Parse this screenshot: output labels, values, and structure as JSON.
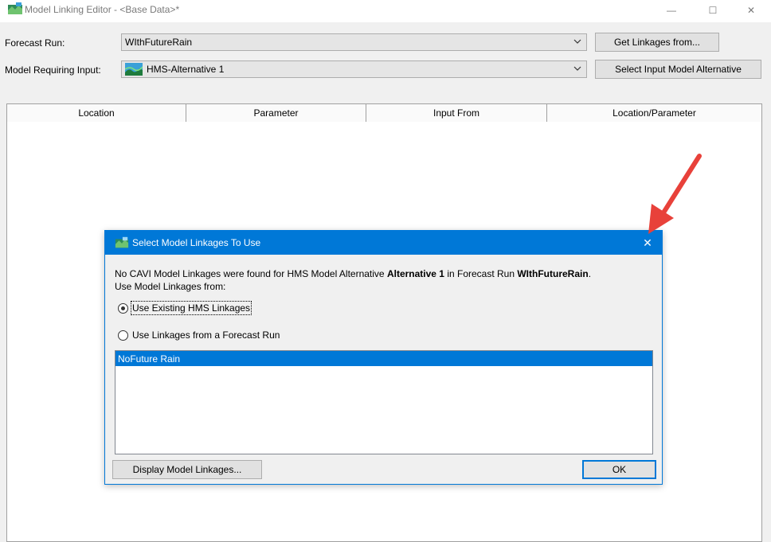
{
  "window": {
    "title": "Model Linking Editor - <Base Data>*",
    "min_glyph": "—",
    "max_glyph": "☐",
    "close_glyph": "✕"
  },
  "form": {
    "forecast_run_label": "Forecast Run:",
    "forecast_run_value": "WIthFutureRain",
    "model_input_label": "Model Requiring Input:",
    "model_input_value": "HMS-Alternative 1",
    "get_linkages_button": "Get Linkages from...",
    "select_input_button": "Select Input Model Alternative"
  },
  "table": {
    "columns": [
      "Location",
      "Parameter",
      "Input From",
      "Location/Parameter"
    ]
  },
  "dialog": {
    "title": "Select Model Linkages To Use",
    "close_glyph": "✕",
    "message_part1": "No CAVI Model Linkages were found for HMS Model Alternative ",
    "message_bold1": "Alternative 1",
    "message_part2": " in Forecast Run ",
    "message_bold2": "WIthFutureRain",
    "message_part3": ".",
    "message_line2": "Use Model Linkages from:",
    "option_existing": "Use Existing HMS Linkages",
    "option_forecast": "Use Linkages from a Forecast Run",
    "list_items": [
      "NoFuture Rain"
    ],
    "display_button": "Display Model Linkages...",
    "ok_button": "OK"
  },
  "colors": {
    "accent": "#0078d7",
    "annotation": "#e8413a"
  },
  "icons": {
    "app": "model-linking-app-icon",
    "model": "hms-model-icon"
  }
}
